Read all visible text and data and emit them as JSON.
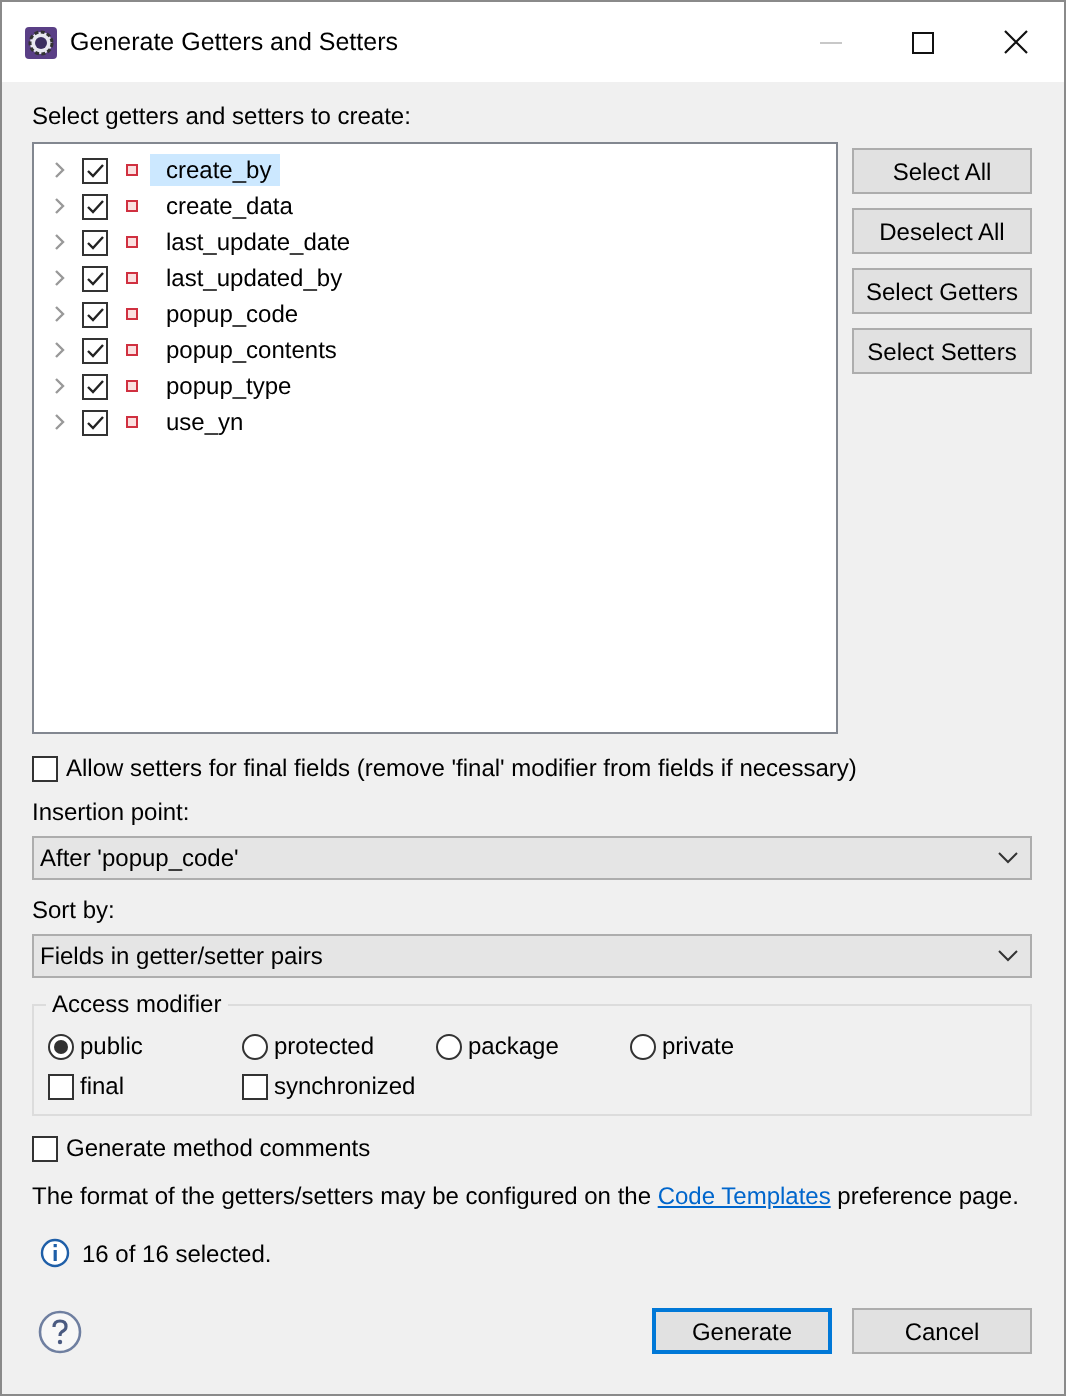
{
  "window": {
    "title": "Generate Getters and Setters"
  },
  "tree": {
    "label": "Select getters and setters to create:",
    "items": [
      {
        "name": "create_by",
        "checked": true,
        "expanded": false,
        "selected": true
      },
      {
        "name": "create_data",
        "checked": true,
        "expanded": false,
        "selected": false
      },
      {
        "name": "last_update_date",
        "checked": true,
        "expanded": false,
        "selected": false
      },
      {
        "name": "last_updated_by",
        "checked": true,
        "expanded": false,
        "selected": false
      },
      {
        "name": "popup_code",
        "checked": true,
        "expanded": false,
        "selected": false
      },
      {
        "name": "popup_contents",
        "checked": true,
        "expanded": false,
        "selected": false
      },
      {
        "name": "popup_type",
        "checked": true,
        "expanded": false,
        "selected": false
      },
      {
        "name": "use_yn",
        "checked": true,
        "expanded": false,
        "selected": false
      }
    ]
  },
  "side_buttons": [
    "Select All",
    "Deselect All",
    "Select Getters",
    "Select Setters"
  ],
  "allow_final_setters": {
    "label": "Allow setters for final fields (remove 'final' modifier from fields if necessary)",
    "checked": false
  },
  "insertion_point": {
    "label": "Insertion point:",
    "value": "After 'popup_code'"
  },
  "sort_by": {
    "label": "Sort by:",
    "value": "Fields in getter/setter pairs"
  },
  "access_modifier": {
    "title": "Access modifier",
    "options": [
      {
        "label": "public",
        "selected": true
      },
      {
        "label": "protected",
        "selected": false
      },
      {
        "label": "package",
        "selected": false
      },
      {
        "label": "private",
        "selected": false
      }
    ],
    "modifiers": [
      {
        "label": "final",
        "checked": false
      },
      {
        "label": "synchronized",
        "checked": false
      }
    ]
  },
  "method_comments": {
    "label": "Generate method comments",
    "checked": false
  },
  "note": {
    "before": "The format of the getters/setters may be configured on the ",
    "link": "Code Templates",
    "after": " preference page."
  },
  "status": "16 of 16 selected.",
  "buttons": [
    {
      "label": "Generate",
      "default": true
    },
    {
      "label": "Cancel",
      "default": false
    }
  ]
}
